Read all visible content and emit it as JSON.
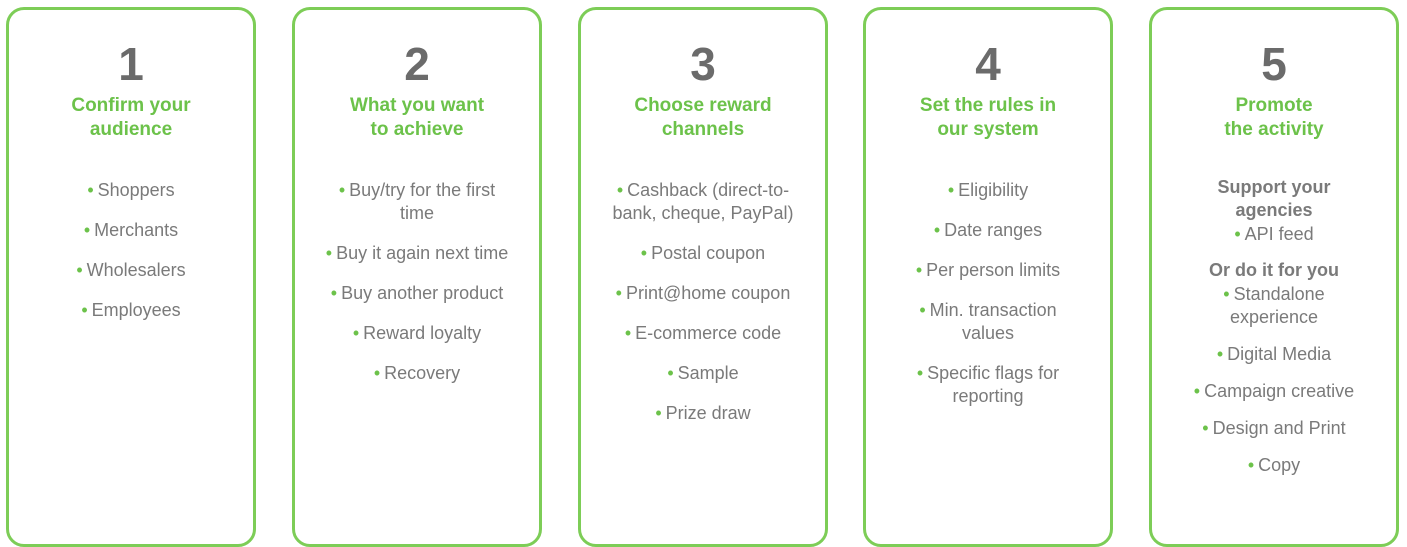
{
  "steps": [
    {
      "number": "1",
      "title": [
        "Confirm your",
        "audience"
      ],
      "items": [
        [
          "Shoppers"
        ],
        [
          "Merchants"
        ],
        [
          "Wholesalers"
        ],
        [
          "Employees"
        ]
      ]
    },
    {
      "number": "2",
      "title": [
        "What you want",
        "to achieve"
      ],
      "items": [
        [
          "Buy/try for the first",
          "time"
        ],
        [
          "Buy it again next time"
        ],
        [
          "Buy another product"
        ],
        [
          "Reward loyalty"
        ],
        [
          "Recovery"
        ]
      ]
    },
    {
      "number": "3",
      "title": [
        "Choose reward",
        "channels"
      ],
      "items": [
        [
          "Cashback (direct-to-",
          "bank, cheque, PayPal)"
        ],
        [
          "Postal coupon"
        ],
        [
          "Print@home coupon"
        ],
        [
          "E-commerce code"
        ],
        [
          "Sample"
        ],
        [
          "Prize draw"
        ]
      ]
    },
    {
      "number": "4",
      "title": [
        "Set the rules in",
        "our system"
      ],
      "items": [
        [
          "Eligibility"
        ],
        [
          "Date ranges"
        ],
        [
          "Per person limits"
        ],
        [
          "Min. transaction",
          "values"
        ],
        [
          "Specific flags for",
          "reporting"
        ]
      ]
    },
    {
      "number": "5",
      "title": [
        "Promote",
        "the activity"
      ],
      "groups": [
        {
          "heading": [
            "Support your",
            "agencies"
          ],
          "items": [
            [
              "API feed"
            ]
          ]
        },
        {
          "heading": [
            "Or do it for you"
          ],
          "items": [
            [
              "Standalone",
              "experience"
            ],
            [
              "Digital Media"
            ],
            [
              "Campaign creative"
            ],
            [
              "Design and Print"
            ],
            [
              "Copy"
            ]
          ]
        }
      ]
    }
  ],
  "colors": {
    "accent": "#6cc24a",
    "border": "#7dcd57",
    "number": "#6b6b6b",
    "text": "#7a7a7a"
  }
}
